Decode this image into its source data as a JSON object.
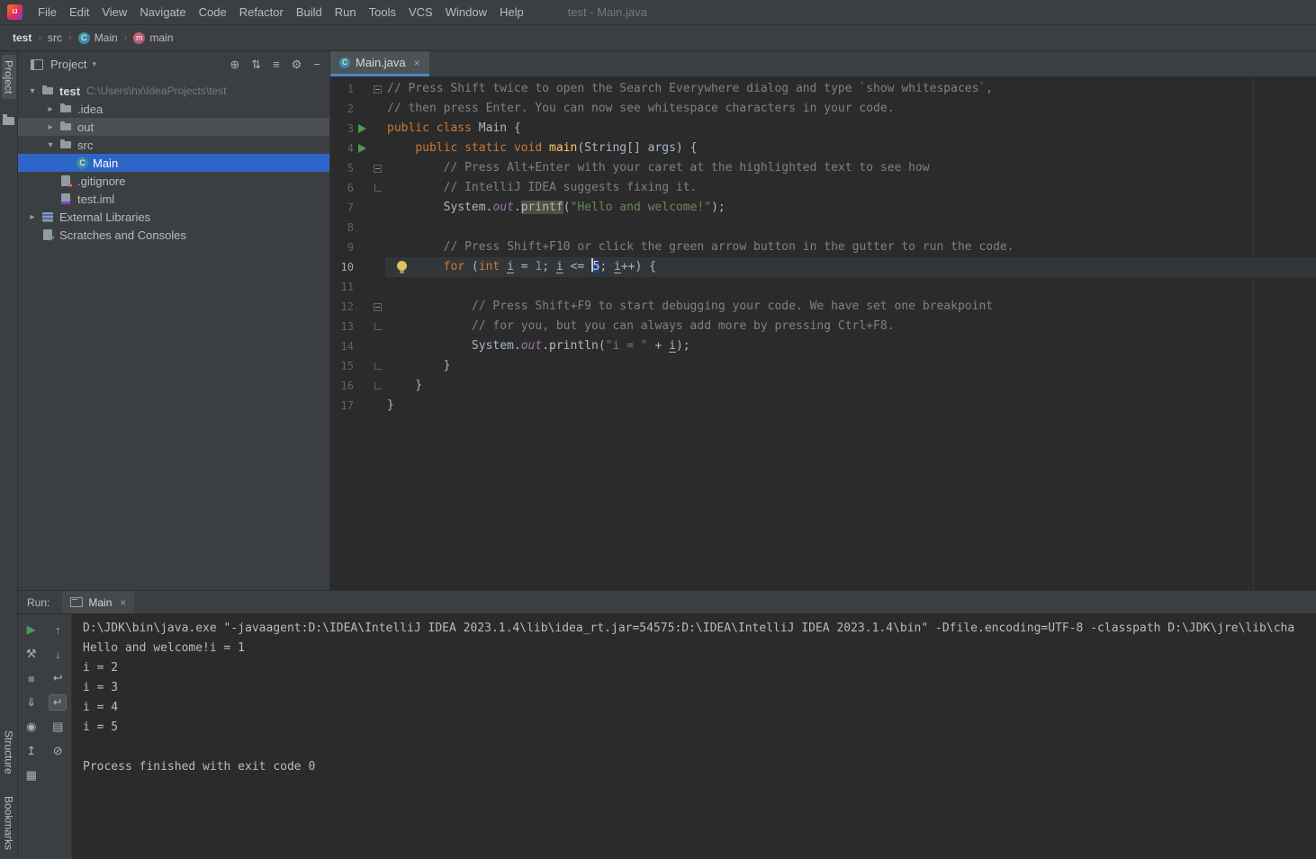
{
  "window": {
    "title": "test - Main.java"
  },
  "menu": {
    "logo": "IJ",
    "items": [
      "File",
      "Edit",
      "View",
      "Navigate",
      "Code",
      "Refactor",
      "Build",
      "Run",
      "Tools",
      "VCS",
      "Window",
      "Help"
    ]
  },
  "breadcrumbs": [
    {
      "label": "test",
      "bold": true
    },
    {
      "label": "src"
    },
    {
      "label": "Main",
      "icon": "class"
    },
    {
      "label": "main",
      "icon": "method"
    }
  ],
  "stripe": {
    "top": [
      {
        "label": "Project"
      }
    ],
    "bottom": [
      {
        "label": "Structure"
      },
      {
        "label": "Bookmarks"
      }
    ]
  },
  "project": {
    "title": "Project",
    "header_icons": [
      "select-opened-file",
      "expand-all",
      "collapse-all",
      "settings",
      "hide"
    ],
    "tree": [
      {
        "indent": 0,
        "chevron": "down",
        "icon": "folder",
        "label": "test",
        "hint": "C:\\Users\\hx\\IdeaProjects\\test",
        "bold": true
      },
      {
        "indent": 1,
        "chevron": "right",
        "icon": "folder",
        "label": ".idea"
      },
      {
        "indent": 1,
        "chevron": "right",
        "icon": "folder",
        "label": "out",
        "state": "hover"
      },
      {
        "indent": 1,
        "chevron": "down",
        "icon": "folder",
        "label": "src"
      },
      {
        "indent": 2,
        "chevron": "none",
        "icon": "class",
        "label": "Main",
        "state": "selected"
      },
      {
        "indent": 1,
        "chevron": "none",
        "icon": "gitignore",
        "label": ".gitignore"
      },
      {
        "indent": 1,
        "chevron": "none",
        "icon": "iml",
        "label": "test.iml"
      },
      {
        "indent": 0,
        "chevron": "right",
        "icon": "library",
        "label": "External Libraries"
      },
      {
        "indent": 0,
        "chevron": "none",
        "icon": "scratches",
        "label": "Scratches and Consoles"
      }
    ]
  },
  "editor": {
    "tab": {
      "label": "Main.java",
      "icon": "class",
      "close": "×"
    },
    "lines": [
      {
        "n": 1,
        "g": "fs",
        "seg": [
          [
            "cmt",
            "// Press Shift twice to open the Search Everywhere dialog and type `show whitespaces`,"
          ]
        ]
      },
      {
        "n": 2,
        "g": "",
        "seg": [
          [
            "cmt",
            "// then press Enter. You can now see whitespace characters in your code."
          ]
        ]
      },
      {
        "n": 3,
        "g": "run",
        "seg": [
          [
            "kw",
            "public class"
          ],
          [
            "pln",
            " Main {"
          ]
        ]
      },
      {
        "n": 4,
        "g": "run",
        "seg": [
          [
            "pln",
            "    "
          ],
          [
            "kw",
            "public static void"
          ],
          [
            "pln",
            " "
          ],
          [
            "mth",
            "main"
          ],
          [
            "pln",
            "(String[] args) {"
          ]
        ]
      },
      {
        "n": 5,
        "g": "fs",
        "seg": [
          [
            "pln",
            "        "
          ],
          [
            "cmt",
            "// Press Alt+Enter with your caret at the highlighted text to see how"
          ]
        ]
      },
      {
        "n": 6,
        "g": "fe",
        "seg": [
          [
            "pln",
            "        "
          ],
          [
            "cmt",
            "// IntelliJ IDEA suggests fixing it."
          ]
        ]
      },
      {
        "n": 7,
        "g": "",
        "seg": [
          [
            "pln",
            "        System."
          ],
          [
            "fld",
            "out"
          ],
          [
            "pln",
            "."
          ],
          [
            "hlw",
            "printf"
          ],
          [
            "pln",
            "("
          ],
          [
            "str",
            "\"Hello and welcome!\""
          ],
          [
            "pln",
            ");"
          ]
        ]
      },
      {
        "n": 8,
        "g": "",
        "seg": []
      },
      {
        "n": 9,
        "g": "",
        "seg": [
          [
            "pln",
            "        "
          ],
          [
            "cmt",
            "// Press Shift+F10 or click the green arrow button in the gutter to run the code."
          ]
        ]
      },
      {
        "n": 10,
        "g": "",
        "bulb": true,
        "current": true,
        "seg": [
          [
            "pln",
            "        "
          ],
          [
            "kw",
            "for"
          ],
          [
            "pln",
            " ("
          ],
          [
            "kw",
            "int"
          ],
          [
            "pln",
            " "
          ],
          [
            "u",
            "i"
          ],
          [
            "pln",
            " = "
          ],
          [
            "num",
            "1"
          ],
          [
            "pln",
            "; "
          ],
          [
            "u",
            "i"
          ],
          [
            "pln",
            " <= "
          ],
          [
            "sel",
            "5"
          ],
          [
            "pln",
            "; "
          ],
          [
            "u",
            "i"
          ],
          [
            "pln",
            "++) {"
          ]
        ]
      },
      {
        "n": 11,
        "g": "",
        "seg": []
      },
      {
        "n": 12,
        "g": "fs",
        "seg": [
          [
            "pln",
            "            "
          ],
          [
            "cmt",
            "// Press Shift+F9 to start debugging your code. We have set one breakpoint"
          ]
        ]
      },
      {
        "n": 13,
        "g": "fe",
        "seg": [
          [
            "pln",
            "            "
          ],
          [
            "cmt",
            "// for you, but you can always add more by pressing Ctrl+F8."
          ]
        ]
      },
      {
        "n": 14,
        "g": "",
        "seg": [
          [
            "pln",
            "            System."
          ],
          [
            "fld",
            "out"
          ],
          [
            "pln",
            ".println("
          ],
          [
            "str",
            "\"i = \""
          ],
          [
            "pln",
            " + "
          ],
          [
            "u",
            "i"
          ],
          [
            "pln",
            ");"
          ]
        ]
      },
      {
        "n": 15,
        "g": "fe",
        "seg": [
          [
            "pln",
            "        }"
          ]
        ]
      },
      {
        "n": 16,
        "g": "fe",
        "seg": [
          [
            "pln",
            "    }"
          ]
        ]
      },
      {
        "n": 17,
        "g": "",
        "seg": [
          [
            "pln",
            "}"
          ]
        ]
      }
    ]
  },
  "run": {
    "label": "Run:",
    "tab": {
      "label": "Main",
      "icon": "console",
      "close": "×"
    },
    "toolbar_primary": [
      "rerun",
      "settings-wrench",
      "stop",
      "dump-threads",
      "screenshot",
      "export",
      "layout"
    ],
    "toolbar_secondary": [
      "scroll-up",
      "scroll-down",
      "line-wrap",
      "soft-wrap",
      "print",
      "clear-all"
    ],
    "console": [
      "D:\\JDK\\bin\\java.exe \"-javaagent:D:\\IDEA\\IntelliJ IDEA 2023.1.4\\lib\\idea_rt.jar=54575:D:\\IDEA\\IntelliJ IDEA 2023.1.4\\bin\" -Dfile.encoding=UTF-8 -classpath D:\\JDK\\jre\\lib\\cha",
      "Hello and welcome!i = 1",
      "i = 2",
      "i = 3",
      "i = 4",
      "i = 5",
      "",
      "Process finished with exit code 0"
    ]
  },
  "colors": {
    "selection_blue": "#2e65c9",
    "run_green": "#499c54",
    "tab_accent": "#4a88c7",
    "keyword": "#cc7832",
    "string": "#6a8759",
    "comment": "#808080",
    "number": "#6897bb",
    "background": "#2b2b2b",
    "panel": "#3c3f41"
  }
}
